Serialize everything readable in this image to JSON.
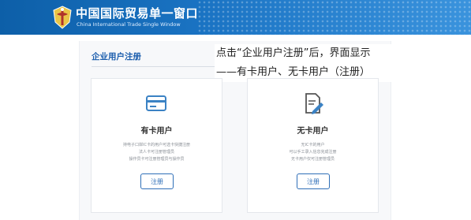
{
  "header": {
    "title": "中国国际贸易单一窗口",
    "subtitle": "China International Trade Single Window",
    "logo_icon": "customs-emblem-icon",
    "colors": {
      "banner": "#1b6dbb",
      "accent": "#2f6fb8"
    }
  },
  "main": {
    "section_title": "企业用户注册",
    "annotation": {
      "line1": "点击“企业用户注册”后，界面显示",
      "line2": "——有卡用户、无卡用户（注册）"
    },
    "cards": [
      {
        "icon": "id-card-icon",
        "title": "有卡用户",
        "desc": [
          "持电子口岸IC卡的用户可选卡快捷注册",
          "法人卡可注册管理员",
          "操作员卡可注册管理员与操作员"
        ],
        "button_label": "注册"
      },
      {
        "icon": "document-edit-icon",
        "title": "无卡用户",
        "desc": [
          "无IC卡的用户",
          "可以手工录入信息完成注册",
          "无卡用户仅可注册管理员"
        ],
        "button_label": "注册"
      }
    ]
  }
}
